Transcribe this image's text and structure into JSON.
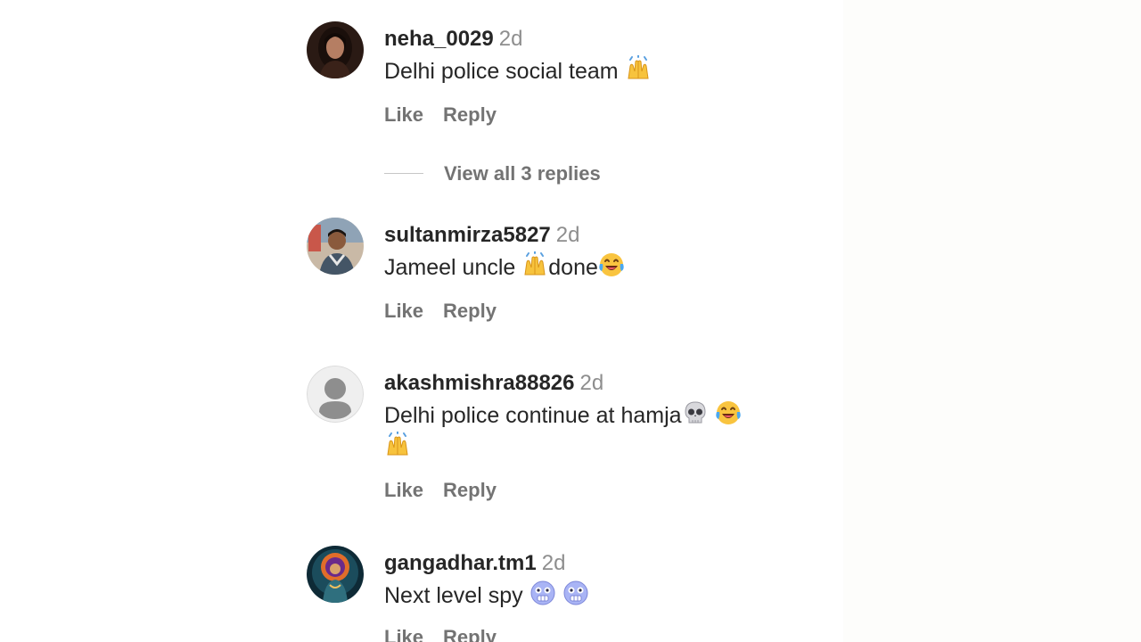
{
  "comments": [
    {
      "username": "neha_0029",
      "time": "2d",
      "text_parts": [
        "Delhi police social team",
        "raising-hands"
      ],
      "like_label": "Like",
      "reply_label": "Reply",
      "view_replies_label": "View all 3 replies"
    },
    {
      "username": "sultanmirza5827",
      "time": "2d",
      "text_parts": [
        "Jameel uncle",
        "raising-hands",
        "done",
        "laughing-tears"
      ],
      "like_label": "Like",
      "reply_label": "Reply"
    },
    {
      "username": "akashmishra88826",
      "time": "2d",
      "text_parts": [
        "Delhi police continue at hamja",
        "skull",
        "laughing-tears",
        "raising-hands"
      ],
      "like_label": "Like",
      "reply_label": "Reply"
    },
    {
      "username": "gangadhar.tm1",
      "time": "2d",
      "text_parts": [
        "Next level spy",
        "cold-face",
        "cold-face"
      ],
      "like_label": "Like",
      "reply_label": "Reply"
    }
  ],
  "colors": {
    "text": "#262626",
    "secondary": "#737373",
    "timestamp": "#8e8e8e"
  }
}
